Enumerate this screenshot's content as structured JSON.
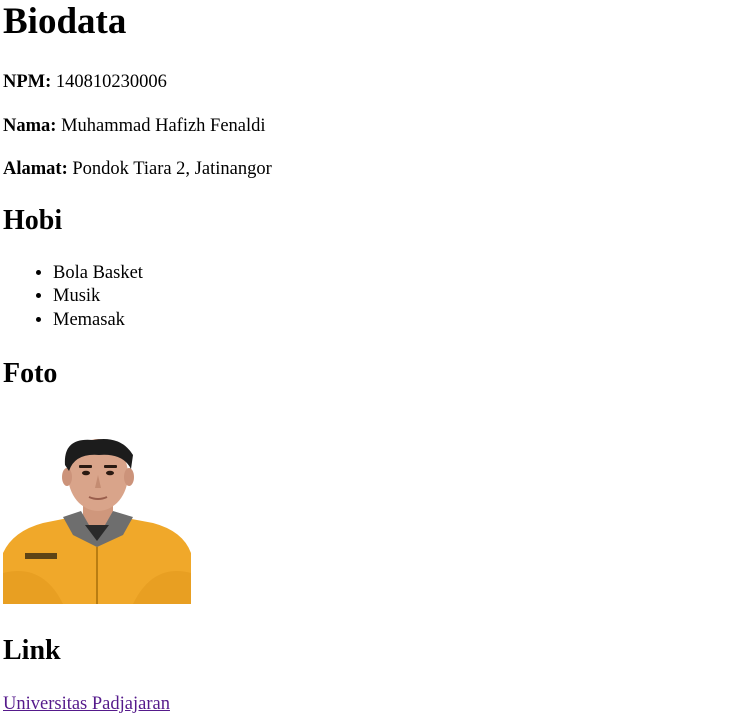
{
  "page": {
    "title": "Biodata",
    "fields": {
      "npm_label": "NPM:",
      "npm_value": "140810230006",
      "nama_label": "Nama:",
      "nama_value": "Muhammad Hafizh Fenaldi",
      "alamat_label": "Alamat:",
      "alamat_value": "Pondok Tiara 2, Jatinangor"
    },
    "hobi": {
      "heading": "Hobi",
      "items": [
        "Bola Basket",
        "Musik",
        "Memasak"
      ]
    },
    "foto": {
      "heading": "Foto",
      "colors": {
        "jacket": "#f0a82a",
        "collar": "#6e6e6e",
        "skin": "#d9a48a",
        "hair": "#1c1c1c"
      }
    },
    "link": {
      "heading": "Link",
      "text": "Universitas Padjajaran",
      "color": "#551a8b"
    }
  }
}
